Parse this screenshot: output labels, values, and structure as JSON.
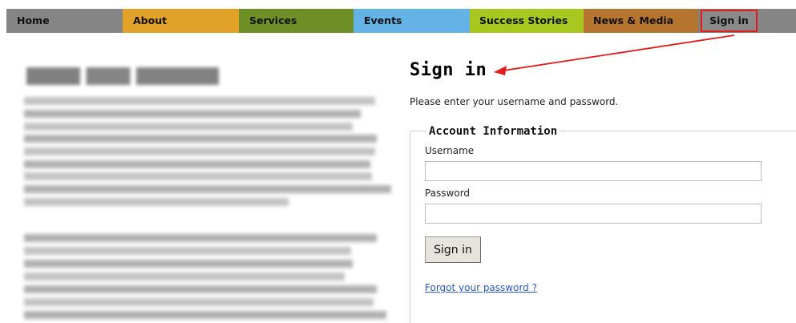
{
  "nav": {
    "items": [
      {
        "label": "Home"
      },
      {
        "label": "About"
      },
      {
        "label": "Services"
      },
      {
        "label": "Events"
      },
      {
        "label": "Success Stories"
      },
      {
        "label": "News & Media"
      },
      {
        "label": "Sign in"
      }
    ],
    "colors": {
      "home": "#858585",
      "about": "#e2a227",
      "services": "#6e8e26",
      "events": "#63b3e6",
      "success": "#a9c81f",
      "news": "#b5752f",
      "highlight": "#e41c1c"
    }
  },
  "main": {
    "title": "Sign in",
    "intro": "Please enter your username and password.",
    "account": {
      "legend": "Account Information",
      "username_label": "Username",
      "username_value": "",
      "password_label": "Password",
      "password_value": "",
      "submit_label": "Sign in",
      "forgot_link": "Forgot your password ?"
    }
  },
  "icons": {
    "annotation": "red-arrow-icon"
  }
}
